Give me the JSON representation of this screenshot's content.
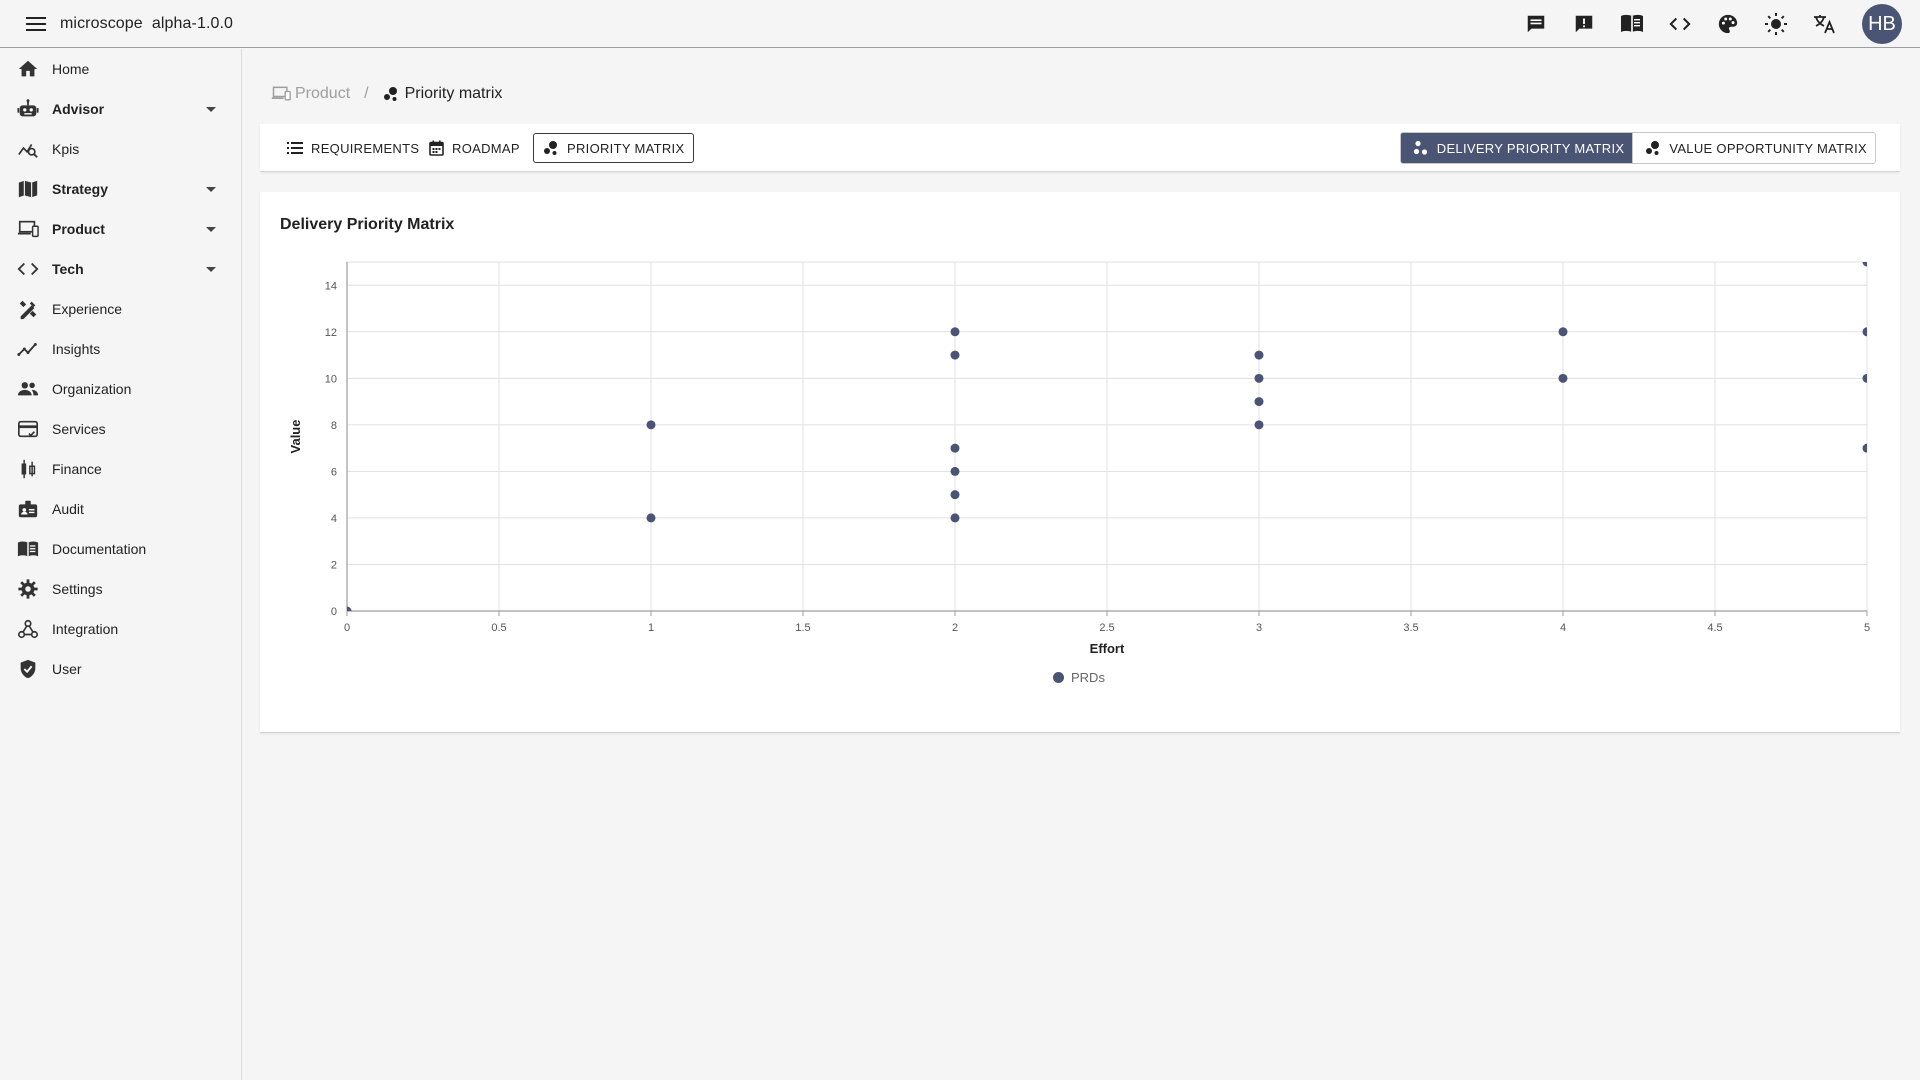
{
  "app": {
    "title": "microscope  alpha-1.0.0"
  },
  "topbar": {
    "icons": [
      "chat-icon",
      "feedback-icon",
      "book-icon",
      "code-icon",
      "palette-icon",
      "brightness-icon",
      "translate-icon"
    ],
    "avatar_initials": "HB"
  },
  "sidebar": {
    "items": [
      {
        "label": "Home",
        "icon": "home-icon",
        "expandable": false,
        "bold": false
      },
      {
        "label": "Advisor",
        "icon": "robot-icon",
        "expandable": true,
        "bold": true
      },
      {
        "label": "Kpis",
        "icon": "query-stats-icon",
        "expandable": false,
        "bold": false
      },
      {
        "label": "Strategy",
        "icon": "map-icon",
        "expandable": true,
        "bold": true
      },
      {
        "label": "Product",
        "icon": "devices-icon",
        "expandable": true,
        "bold": true
      },
      {
        "label": "Tech",
        "icon": "code-icon",
        "expandable": true,
        "bold": true
      },
      {
        "label": "Experience",
        "icon": "design-tools-icon",
        "expandable": false,
        "bold": false
      },
      {
        "label": "Insights",
        "icon": "insights-icon",
        "expandable": false,
        "bold": false
      },
      {
        "label": "Organization",
        "icon": "people-icon",
        "expandable": false,
        "bold": false
      },
      {
        "label": "Services",
        "icon": "card-icon",
        "expandable": false,
        "bold": false
      },
      {
        "label": "Finance",
        "icon": "candlestick-icon",
        "expandable": false,
        "bold": false
      },
      {
        "label": "Audit",
        "icon": "badge-icon",
        "expandable": false,
        "bold": false
      },
      {
        "label": "Documentation",
        "icon": "menu-book-icon",
        "expandable": false,
        "bold": false
      },
      {
        "label": "Settings",
        "icon": "gear-icon",
        "expandable": false,
        "bold": false
      },
      {
        "label": "Integration",
        "icon": "webhook-icon",
        "expandable": false,
        "bold": false
      },
      {
        "label": "User",
        "icon": "shield-check-icon",
        "expandable": false,
        "bold": false
      }
    ]
  },
  "breadcrumb": {
    "parent": "Product",
    "separator": "/",
    "current": "Priority matrix"
  },
  "tabs": [
    {
      "label": "REQUIREMENTS",
      "icon": "list-icon",
      "active": false
    },
    {
      "label": "ROADMAP",
      "icon": "calendar-icon",
      "active": false
    },
    {
      "label": "PRIORITY MATRIX",
      "icon": "bubble-chart-icon",
      "active": true
    }
  ],
  "matrix_toggle": {
    "delivery": "DELIVERY PRIORITY MATRIX",
    "value": "VALUE OPPORTUNITY MATRIX",
    "selected": "delivery"
  },
  "colors": {
    "accent": "#4a5475",
    "grid": "#e0e0e0",
    "axis": "#9e9e9e"
  },
  "chart_data": {
    "type": "scatter",
    "title": "Delivery Priority Matrix",
    "xlabel": "Effort",
    "ylabel": "Value",
    "xlim": [
      0,
      5
    ],
    "ylim": [
      0,
      15
    ],
    "xticks": [
      0,
      0.5,
      1,
      1.5,
      2,
      2.5,
      3,
      3.5,
      4,
      4.5,
      5
    ],
    "yticks": [
      0,
      2,
      4,
      6,
      8,
      10,
      12,
      14
    ],
    "grid": true,
    "legend_position": "bottom-center",
    "series": [
      {
        "name": "PRDs",
        "points": [
          [
            0,
            0
          ],
          [
            1,
            8
          ],
          [
            1,
            4
          ],
          [
            2,
            12
          ],
          [
            2,
            11
          ],
          [
            2,
            7
          ],
          [
            2,
            6
          ],
          [
            2,
            5
          ],
          [
            2,
            4
          ],
          [
            3,
            11
          ],
          [
            3,
            10
          ],
          [
            3,
            9
          ],
          [
            3,
            8
          ],
          [
            4,
            12
          ],
          [
            4,
            10
          ],
          [
            5,
            15
          ],
          [
            5,
            12
          ],
          [
            5,
            10
          ],
          [
            5,
            7
          ]
        ]
      }
    ]
  }
}
